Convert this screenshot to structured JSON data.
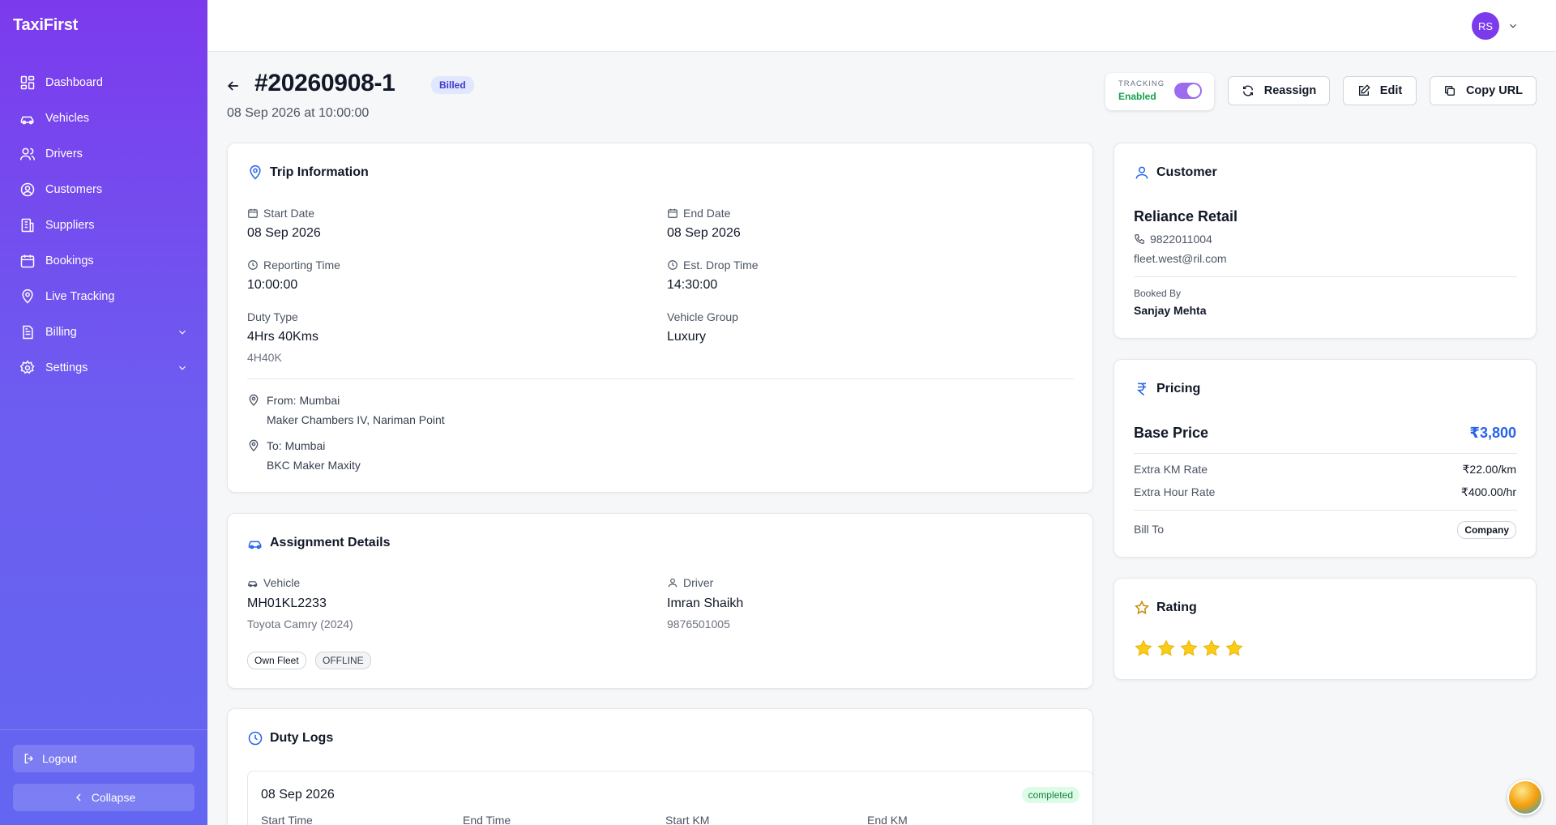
{
  "app": {
    "brand": "TaxiFirst"
  },
  "sidebar": {
    "items": [
      {
        "label": "Dashboard",
        "icon": "dashboard-icon"
      },
      {
        "label": "Vehicles",
        "icon": "car-icon"
      },
      {
        "label": "Drivers",
        "icon": "users-icon"
      },
      {
        "label": "Customers",
        "icon": "user-circle-icon"
      },
      {
        "label": "Suppliers",
        "icon": "building-icon"
      },
      {
        "label": "Bookings",
        "icon": "calendar-icon"
      },
      {
        "label": "Live Tracking",
        "icon": "map-pin-icon"
      },
      {
        "label": "Billing",
        "icon": "file-icon",
        "expandable": true
      },
      {
        "label": "Settings",
        "icon": "gear-icon",
        "expandable": true
      }
    ],
    "logout_label": "Logout",
    "collapse_label": "Collapse"
  },
  "topbar": {
    "avatar_initials": "RS"
  },
  "header": {
    "title": "#20260908-1",
    "status": "Billed",
    "subtitle": "08 Sep 2026 at 10:00:00",
    "tracking_label": "TRACKING",
    "tracking_value": "Enabled",
    "tracking_on": true,
    "reassign_label": "Reassign",
    "edit_label": "Edit",
    "copy_url_label": "Copy URL"
  },
  "trip": {
    "title": "Trip Information",
    "start_date_label": "Start Date",
    "start_date": "08 Sep 2026",
    "end_date_label": "End Date",
    "end_date": "08 Sep 2026",
    "reporting_time_label": "Reporting Time",
    "reporting_time": "10:00:00",
    "drop_time_label": "Est. Drop Time",
    "drop_time": "14:30:00",
    "duty_type_label": "Duty Type",
    "duty_type": "4Hrs 40Kms",
    "duty_type_code": "4H40K",
    "vehicle_group_label": "Vehicle Group",
    "vehicle_group": "Luxury",
    "from_title": "From: Mumbai",
    "from_address": "Maker Chambers IV, Nariman Point",
    "to_title": "To: Mumbai",
    "to_address": "BKC Maker Maxity"
  },
  "assignment": {
    "title": "Assignment Details",
    "vehicle_label": "Vehicle",
    "vehicle_number": "MH01KL2233",
    "vehicle_model": "Toyota Camry (2024)",
    "driver_label": "Driver",
    "driver_name": "Imran Shaikh",
    "driver_phone": "9876501005",
    "chips": [
      "Own Fleet",
      "OFFLINE"
    ]
  },
  "duty_logs": {
    "title": "Duty Logs",
    "date": "08 Sep 2026",
    "status": "completed",
    "columns": [
      "Start Time",
      "End Time",
      "Start KM",
      "End KM"
    ]
  },
  "customer": {
    "title": "Customer",
    "name": "Reliance Retail",
    "phone": "9822011004",
    "email": "fleet.west@ril.com",
    "booked_by_label": "Booked By",
    "booked_by": "Sanjay Mehta"
  },
  "pricing": {
    "title": "Pricing",
    "base_price_label": "Base Price",
    "base_price": "₹3,800",
    "extra_km_label": "Extra KM Rate",
    "extra_km": "₹22.00/km",
    "extra_hour_label": "Extra Hour Rate",
    "extra_hour": "₹400.00/hr",
    "bill_to_label": "Bill To",
    "bill_to": "Company"
  },
  "rating": {
    "title": "Rating",
    "value": 5,
    "max": 5
  },
  "colors": {
    "accent": "#7c3aed",
    "link": "#2563eb",
    "star": "#facc15",
    "success": "#16a34a"
  }
}
